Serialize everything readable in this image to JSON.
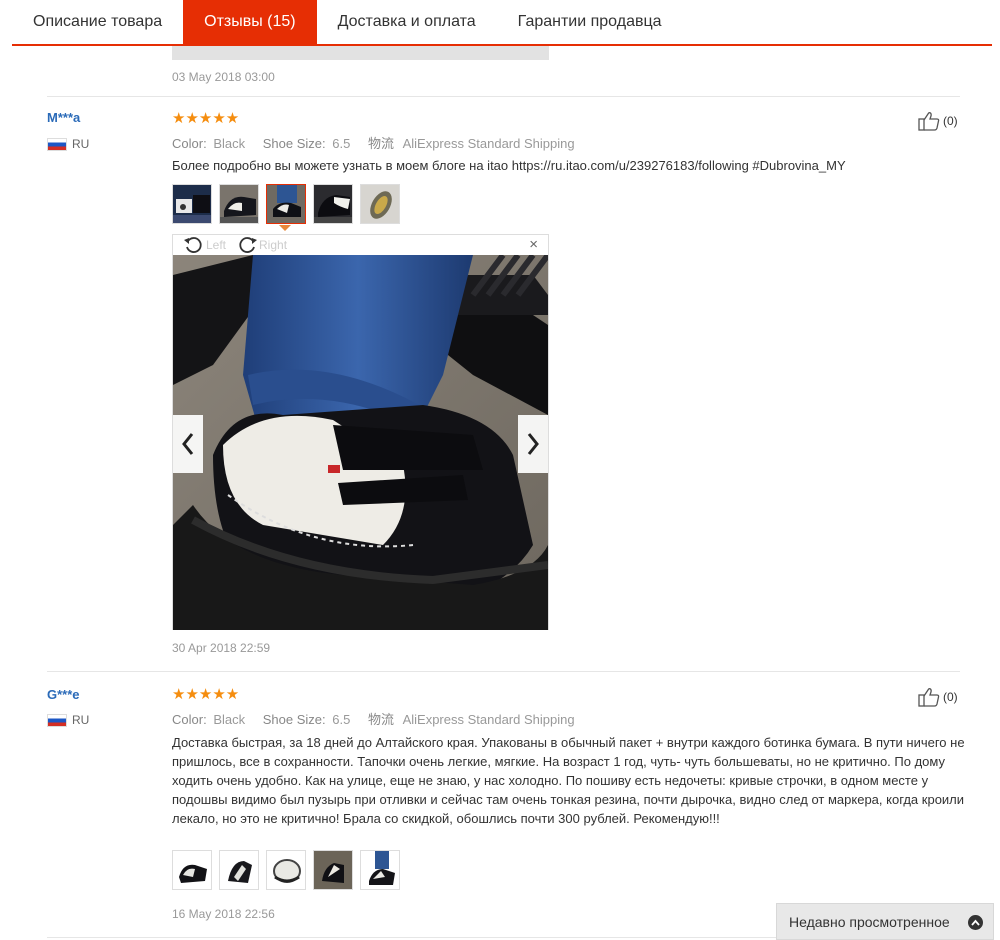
{
  "tabs": [
    {
      "label": "Описание товара",
      "active": false
    },
    {
      "label": "Отзывы (15)",
      "active": true
    },
    {
      "label": "Доставка и оплата",
      "active": false
    },
    {
      "label": "Гарантии продавца",
      "active": false
    }
  ],
  "previous_review": {
    "date": "03 May 2018 03:00"
  },
  "reviews": [
    {
      "user": "M***a",
      "country": "RU",
      "rating": 5,
      "stars": "★★★★★",
      "color_label": "Color:",
      "color_value": "Black",
      "size_label": "Shoe Size:",
      "size_value": "6.5",
      "shipping_label": "物流",
      "shipping_value": "AliExpress Standard Shipping",
      "text": "Более подробно вы можете узнать в моем блоге на itao https://ru.itao.com/u/239276183/following #Dubrovina_MY",
      "helpful_count": "(0)",
      "photo_count": 5,
      "selected_photo": 3,
      "viewer": {
        "rotate_left": "Left",
        "rotate_right": "Right",
        "close": "×"
      },
      "date": "30 Apr 2018 22:59"
    },
    {
      "user": "G***e",
      "country": "RU",
      "rating": 5,
      "stars": "★★★★★",
      "color_label": "Color:",
      "color_value": "Black",
      "size_label": "Shoe Size:",
      "size_value": "6.5",
      "shipping_label": "物流",
      "shipping_value": "AliExpress Standard Shipping",
      "text": "Доставка быстрая, за 18 дней до Алтайского края. Упакованы в обычный пакет + внутри каждого ботинка бумага. В пути ничего не пришлось, все в сохранности. Тапочки очень легкие, мягкие. На возраст 1 год, чуть- чуть большеваты, но не критично. По дому ходить очень удобно. Как на улице, еще не знаю, у нас холодно. По пошиву есть недочеты: кривые строчки, в одном месте у подошвы видимо был пузырь при отливки и сейчас там очень тонкая резина, почти дырочка, видно след от маркера, когда кроили лекало, но это не критично! Брала со скидкой, обошлись почти 300 рублей. Рекомендую!!!",
      "helpful_count": "(0)",
      "photo_count": 5,
      "date": "16 May 2018 22:56"
    }
  ],
  "recently_viewed": {
    "label": "Недавно просмотренное"
  },
  "colors": {
    "accent": "#e62e04",
    "star": "#f58d0f",
    "username": "#2a6ab8"
  }
}
